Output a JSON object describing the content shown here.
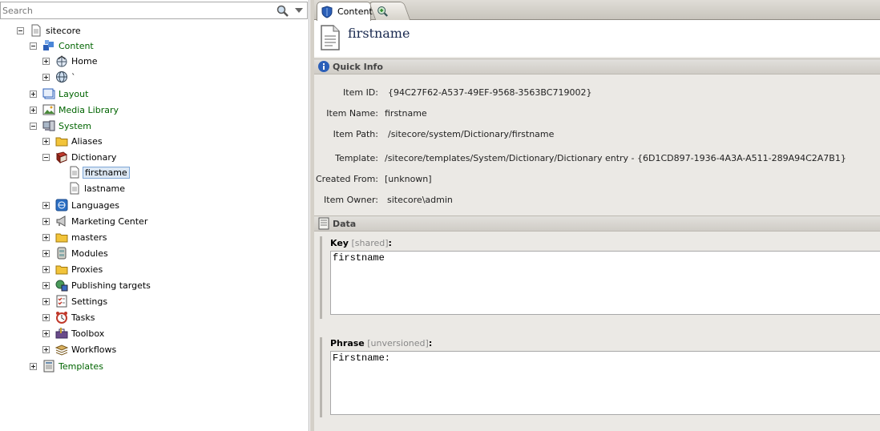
{
  "search": {
    "placeholder": "Search"
  },
  "tree": {
    "root": "sitecore",
    "content": "Content",
    "home": "Home",
    "unnamed": "`",
    "layout": "Layout",
    "media_library": "Media Library",
    "system": "System",
    "aliases": "Aliases",
    "dictionary": "Dictionary",
    "firstname": "firstname",
    "lastname": "lastname",
    "languages": "Languages",
    "marketing_center": "Marketing Center",
    "masters": "masters",
    "modules": "Modules",
    "proxies": "Proxies",
    "publishing_targets": "Publishing targets",
    "settings": "Settings",
    "tasks": "Tasks",
    "toolbox": "Toolbox",
    "workflows": "Workflows",
    "templates": "Templates"
  },
  "tabs": {
    "content": "Content"
  },
  "editor": {
    "title": "firstname",
    "quick_info": {
      "title": "Quick Info",
      "item_id_label": "Item ID:",
      "item_id": "{94C27F62-A537-49EF-9568-3563BC719002}",
      "item_name_label": "Item Name:",
      "item_name": "firstname",
      "item_path_label": "Item Path:",
      "item_path": "/sitecore/system/Dictionary/firstname",
      "template_label": "Template:",
      "template": "/sitecore/templates/System/Dictionary/Dictionary entry -  {6D1CD897-1936-4A3A-A511-289A94C2A7B1}",
      "created_from_label": "Created From:",
      "created_from": "[unknown]",
      "item_owner_label": "Item Owner:",
      "item_owner": "sitecore\\admin"
    },
    "data": {
      "title": "Data",
      "key_label": "Key",
      "key_meta": "[shared]",
      "key_value": "firstname",
      "phrase_label": "Phrase",
      "phrase_meta": "[unversioned]",
      "phrase_value": "Firstname:",
      "colon": ":"
    }
  },
  "colors": {
    "green_label": "#006400",
    "selection": "#dde8f4"
  }
}
